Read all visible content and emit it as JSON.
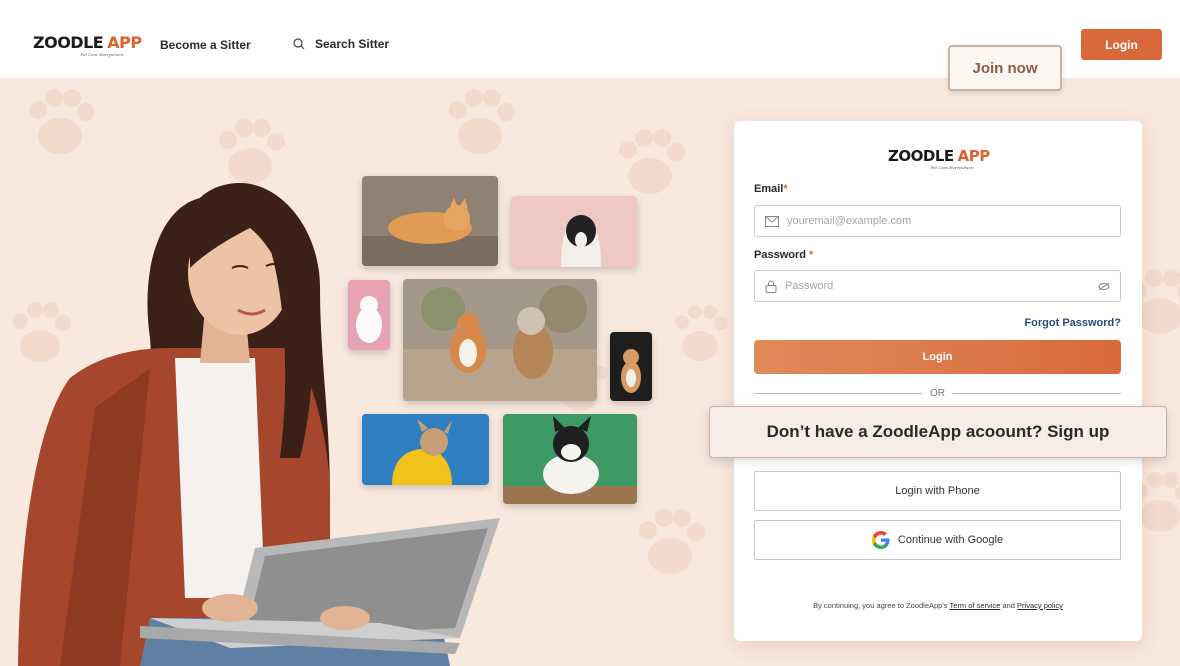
{
  "header": {
    "logo": {
      "word1": "ZOODLE",
      "word2": "APP",
      "tagline": "Pet Care Everywhere"
    },
    "nav": {
      "become_sitter": "Become a Sitter",
      "search_sitter": "Search Sitter"
    },
    "login_label": "Login",
    "join_label": "Join now"
  },
  "card": {
    "logo": {
      "word1": "ZOODLE",
      "word2": "APP",
      "tagline": "Pet Care Everywhere"
    },
    "email_label": "Email",
    "email_placeholder": "youremail@example.com",
    "password_label": "Password",
    "password_placeholder": "Password",
    "required_mark": "*",
    "forgot_label": "Forgot Password?",
    "login_label": "Login",
    "or_label": "OR",
    "signup_text": "Don’t have a ZoodleApp acoount? Sign up",
    "phone_label": "Login with Phone",
    "google_label": "Continue with Google",
    "terms": {
      "prefix": "By continuing, you agree to ZoodleApp's",
      "term_link": "Term of service",
      "and": "and",
      "privacy_link": "Privacy policy"
    }
  },
  "colors": {
    "accent": "#d9683a",
    "background": "#f8e8de",
    "link": "#2c4a7a"
  },
  "icons": [
    "search-icon",
    "mail-icon",
    "lock-icon",
    "eye-off-icon",
    "google-icon"
  ]
}
